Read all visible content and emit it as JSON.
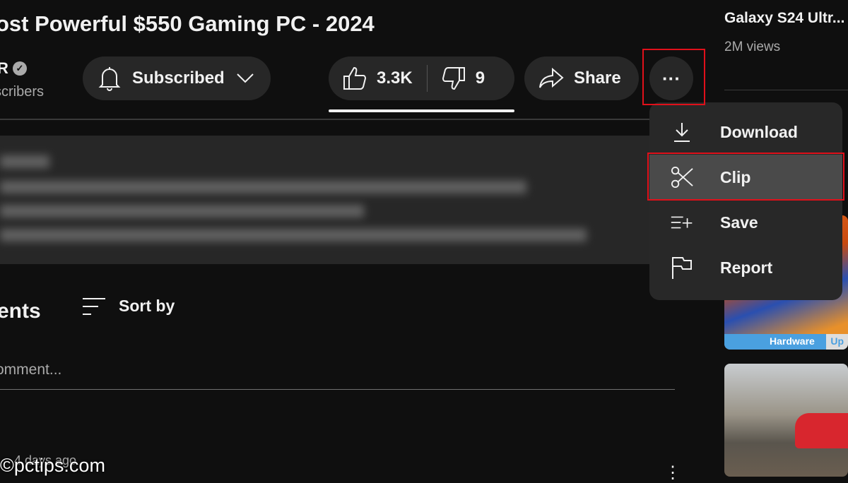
{
  "video": {
    "title": "ost Powerful $550 Gaming PC - 2024",
    "channel_name": "R",
    "subscribers_label": "scribers",
    "subscribe_label": "Subscribed",
    "likes": "3.3K",
    "dislikes": "9",
    "share_label": "Share",
    "more_label": "···"
  },
  "menu": {
    "items": [
      {
        "label": "Download",
        "icon": "download-icon"
      },
      {
        "label": "Clip",
        "icon": "scissors-icon",
        "highlighted": true
      },
      {
        "label": "Save",
        "icon": "playlist-add-icon"
      },
      {
        "label": "Report",
        "icon": "flag-icon"
      }
    ]
  },
  "comments": {
    "heading": "ents",
    "sort_label": "Sort by",
    "add_placeholder": "omment...",
    "first_comment_time": "4 days ago"
  },
  "sidebar": {
    "video_title": "Galaxy S24 Ultr...",
    "video_views": "2M views",
    "thumb_tag_1": "Hardware",
    "thumb_tag_2": "Up"
  },
  "watermark": "©pctips.com",
  "colors": {
    "highlight_box": "#e0101a",
    "background": "#0f0f0f",
    "pill": "#272727"
  }
}
